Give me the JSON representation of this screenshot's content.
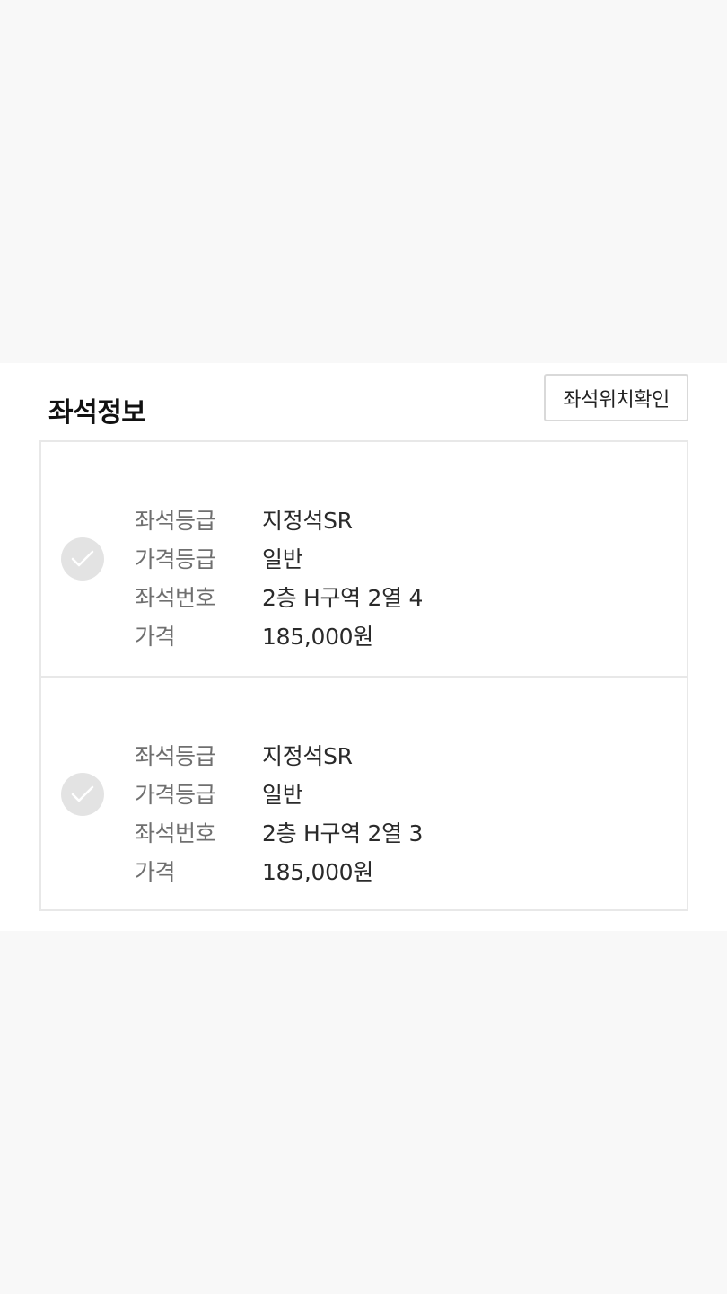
{
  "seat_info": {
    "title": "좌석정보",
    "locate_button_label": "좌석위치확인",
    "items": [
      {
        "selected": true,
        "rows": [
          {
            "label": "좌석등급",
            "value": "지정석SR"
          },
          {
            "label": "가격등급",
            "value": "일반"
          },
          {
            "label": "좌석번호",
            "value": "2층 H구역 2열 4"
          },
          {
            "label": "가격",
            "value": "185,000원"
          }
        ]
      },
      {
        "selected": true,
        "rows": [
          {
            "label": "좌석등급",
            "value": "지정석SR"
          },
          {
            "label": "가격등급",
            "value": "일반"
          },
          {
            "label": "좌석번호",
            "value": "2층 H구역 2열 3"
          },
          {
            "label": "가격",
            "value": "185,000원"
          }
        ]
      }
    ]
  },
  "icons": {
    "check": "check-icon"
  },
  "colors": {
    "background": "#f8f8f8",
    "panel": "#ffffff",
    "check_circle": "#e3e3e3",
    "label_text": "#6f6f6f",
    "value_text": "#2a2a2a"
  }
}
